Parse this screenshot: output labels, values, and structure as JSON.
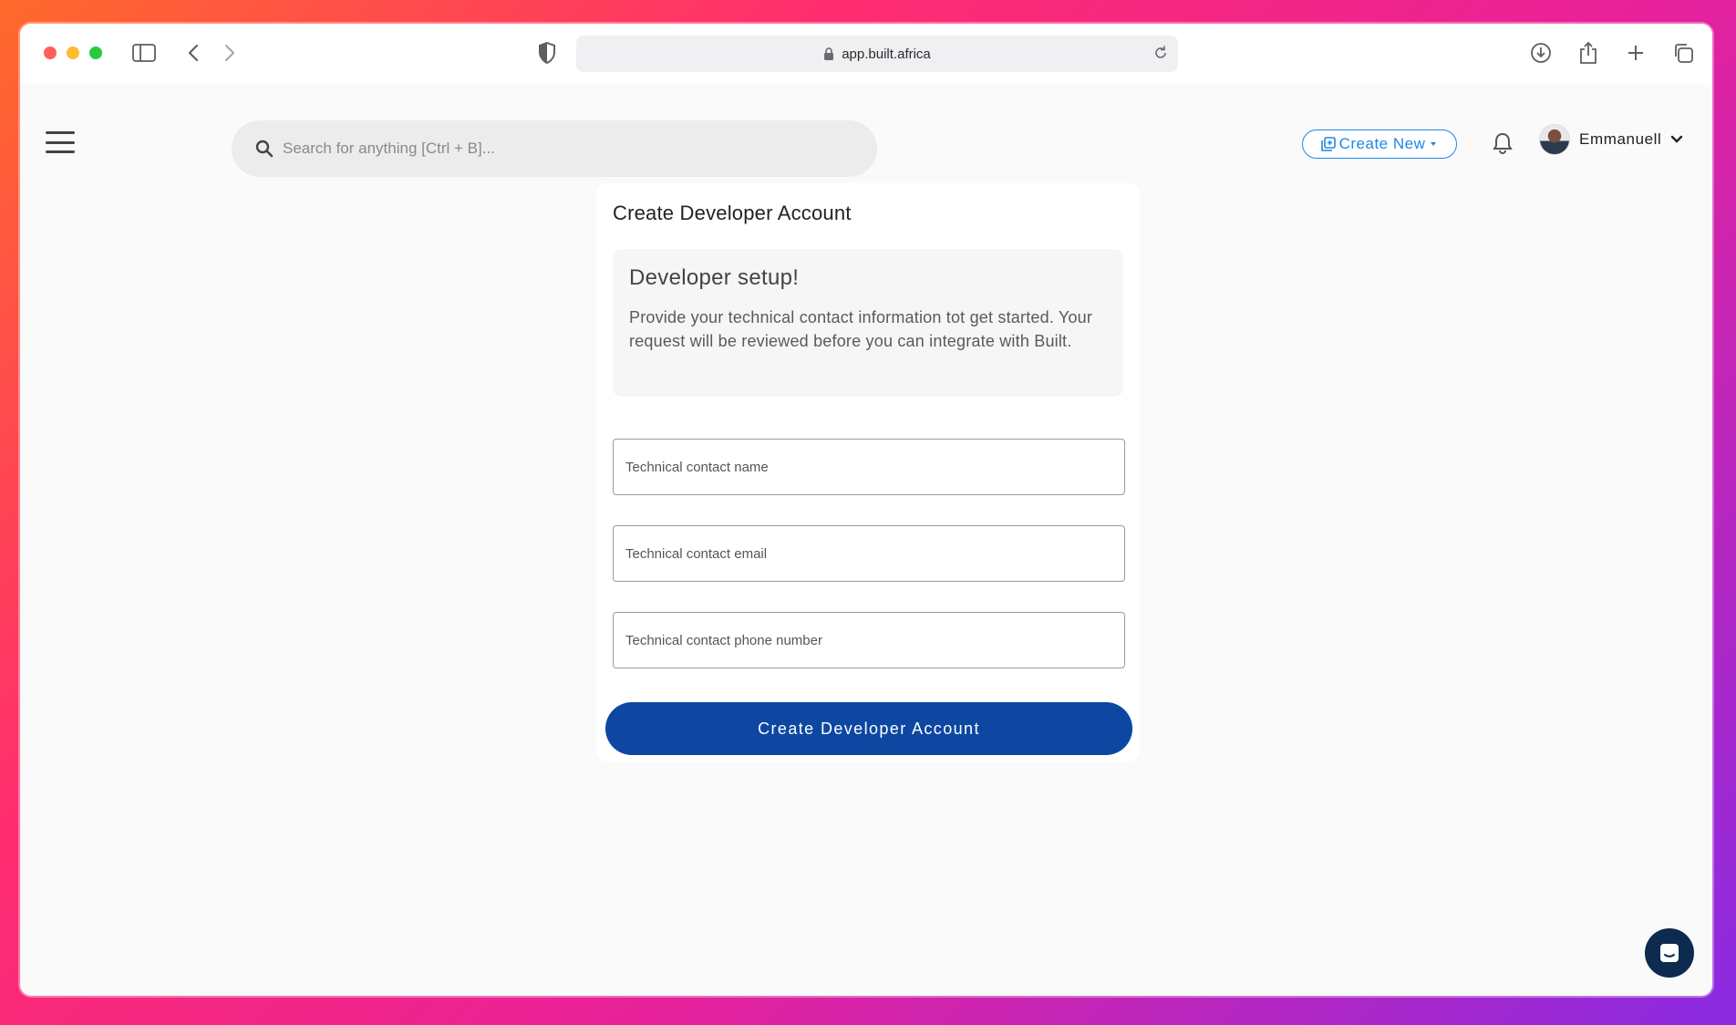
{
  "browser": {
    "url": "app.built.africa"
  },
  "header": {
    "search_placeholder": "Search for anything [Ctrl + B]...",
    "create_new_label": "Create New",
    "user_name": "Emmanuell"
  },
  "card": {
    "title": "Create Developer Account",
    "info_heading": "Developer setup!",
    "info_body": "Provide your technical contact information tot get started. Your request will be reviewed before you can integrate with Built.",
    "fields": [
      {
        "placeholder": "Technical contact name"
      },
      {
        "placeholder": "Technical contact email"
      },
      {
        "placeholder": "Technical contact phone number"
      }
    ],
    "submit_label": "Create Developer Account"
  },
  "colors": {
    "primary": "#0d47a1",
    "accent": "#1e88e5",
    "chat": "#0d2b4e"
  }
}
